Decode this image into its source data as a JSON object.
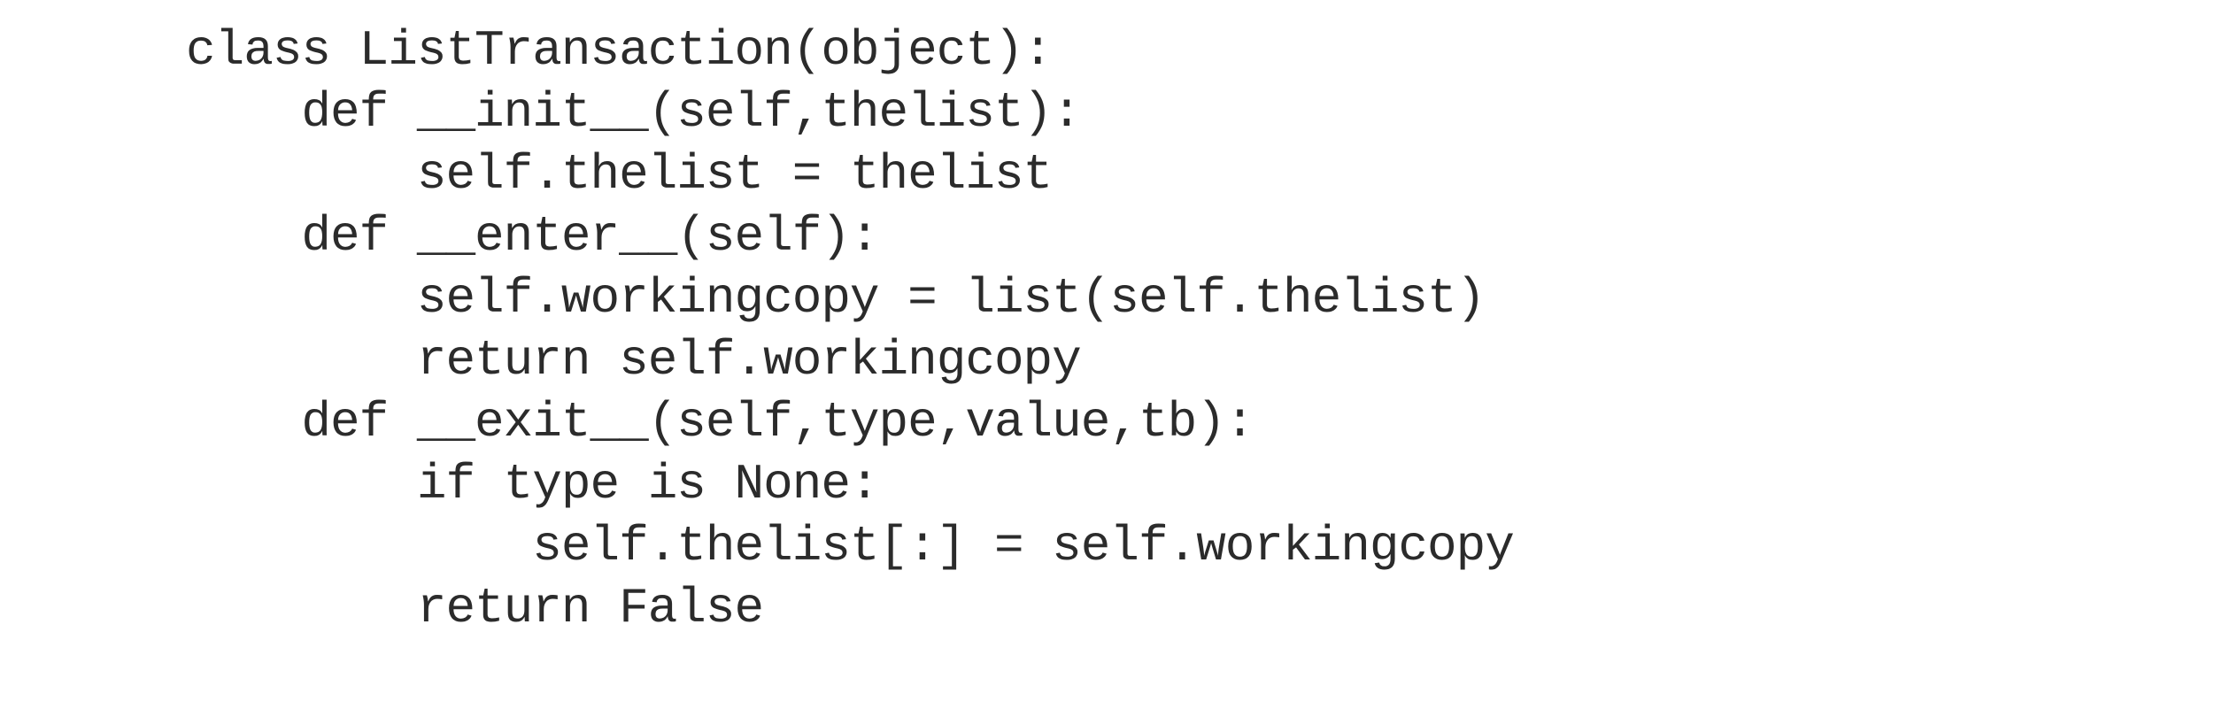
{
  "code": {
    "language": "python",
    "lines": [
      "class ListTransaction(object):",
      "    def __init__(self,thelist):",
      "        self.thelist = thelist",
      "    def __enter__(self):",
      "        self.workingcopy = list(self.thelist)",
      "        return self.workingcopy",
      "    def __exit__(self,type,value,tb):",
      "        if type is None:",
      "            self.thelist[:] = self.workingcopy",
      "        return False"
    ]
  }
}
